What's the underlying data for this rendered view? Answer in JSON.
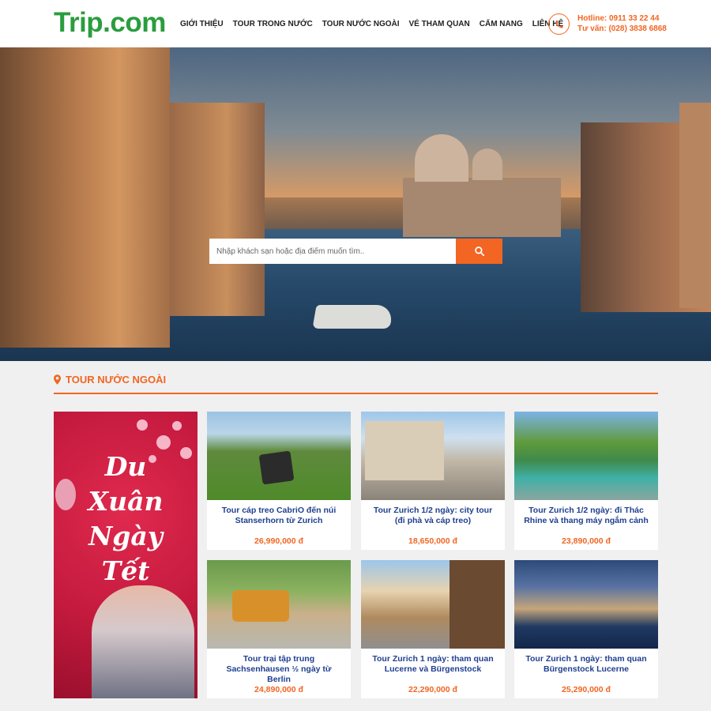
{
  "header": {
    "logo": "Trip.com",
    "nav": [
      "GIỚI THIỆU",
      "TOUR TRONG NƯỚC",
      "TOUR NƯỚC NGOÀI",
      "VÉ THAM QUAN",
      "CẨM NANG",
      "LIÊN HỆ"
    ],
    "hotline": "Hotline: 0911 33 22 44",
    "consult": "Tư vấn: (028) 3838 6868",
    "phone_icon": "phone-icon"
  },
  "search": {
    "placeholder": "Nhập khách sạn hoặc địa điểm muốn tìm..",
    "icon": "search-icon"
  },
  "section": {
    "title": "TOUR NƯỚC NGOÀI",
    "icon": "map-pin-icon"
  },
  "promo": {
    "lines": [
      "Du",
      "Xuân",
      "Ngày",
      "Tết"
    ]
  },
  "tours": [
    {
      "title": "Tour cáp treo CabriO đến núi Stanserhorn từ Zurich",
      "price": "26,990,000 đ"
    },
    {
      "title": "Tour Zurich 1/2 ngày: city tour (đi phà và cáp treo)",
      "price": "18,650,000 đ"
    },
    {
      "title": "Tour Zurich 1/2 ngày: đi Thác Rhine và thang máy ngắm cảnh",
      "price": "23,890,000 đ"
    },
    {
      "title": "Tour trại tập trung Sachsenhausen ½ ngày từ Berlin",
      "price": "24,890,000 đ"
    },
    {
      "title": "Tour Zurich 1 ngày: tham quan Lucerne và Bürgenstock",
      "price": "22,290,000 đ"
    },
    {
      "title": "Tour Zurich 1 ngày: tham quan Bürgenstock Lucerne",
      "price": "25,290,000 đ"
    }
  ],
  "colors": {
    "accent": "#f26522",
    "brand_green": "#2a9d3d",
    "title_blue": "#1f3f8f"
  }
}
